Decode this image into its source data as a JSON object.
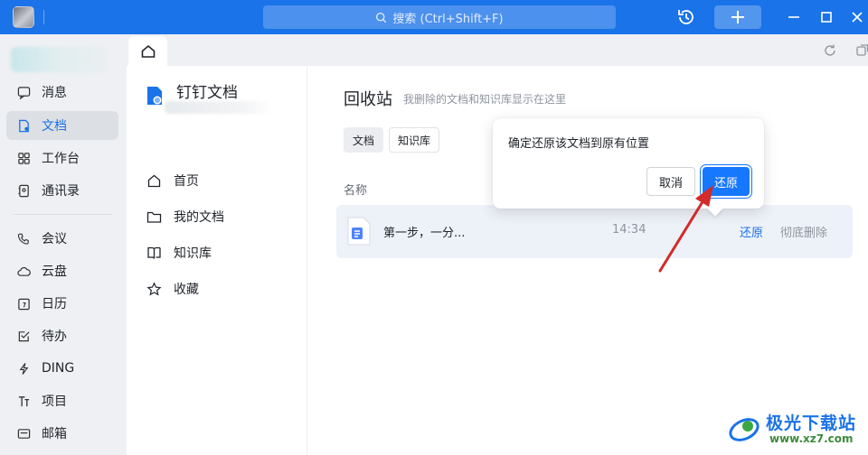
{
  "colors": {
    "accent": "#1a73e8",
    "titlebar": "#1a73e8",
    "arrow": "#d32a2a",
    "row_bg": "#edf1f8"
  },
  "titlebar": {
    "search_placeholder": "搜索 (Ctrl+Shift+F)"
  },
  "leftnav": {
    "items": [
      {
        "label": "消息",
        "icon": "message-icon"
      },
      {
        "label": "文档",
        "icon": "document-icon",
        "active": true
      },
      {
        "label": "工作台",
        "icon": "workbench-icon"
      },
      {
        "label": "通讯录",
        "icon": "contacts-icon"
      },
      {
        "label": "会议",
        "icon": "meeting-icon"
      },
      {
        "label": "云盘",
        "icon": "cloud-icon"
      },
      {
        "label": "日历",
        "icon": "calendar-icon"
      },
      {
        "label": "待办",
        "icon": "todo-icon"
      },
      {
        "label": "DING",
        "icon": "ding-icon"
      },
      {
        "label": "项目",
        "icon": "project-icon"
      },
      {
        "label": "邮箱",
        "icon": "mail-icon"
      }
    ]
  },
  "docs_sidebar": {
    "title": "钉钉文档",
    "items": [
      {
        "label": "首页",
        "icon": "home-icon"
      },
      {
        "label": "我的文档",
        "icon": "folder-icon"
      },
      {
        "label": "知识库",
        "icon": "book-icon"
      },
      {
        "label": "收藏",
        "icon": "star-icon"
      }
    ]
  },
  "main": {
    "title": "回收站",
    "subtitle": "我删除的文档和知识库显示在这里",
    "filters": [
      "文档",
      "知识库"
    ],
    "column_name": "名称",
    "rows": [
      {
        "name": "第一步，一分...",
        "time": "14:34",
        "restore": "还原",
        "delete": "彻底删除"
      }
    ]
  },
  "popover": {
    "message": "确定还原该文档到原有位置",
    "cancel": "取消",
    "confirm": "还原"
  },
  "watermark": {
    "brand": "极光下载站",
    "url": "www.xz7.com"
  }
}
